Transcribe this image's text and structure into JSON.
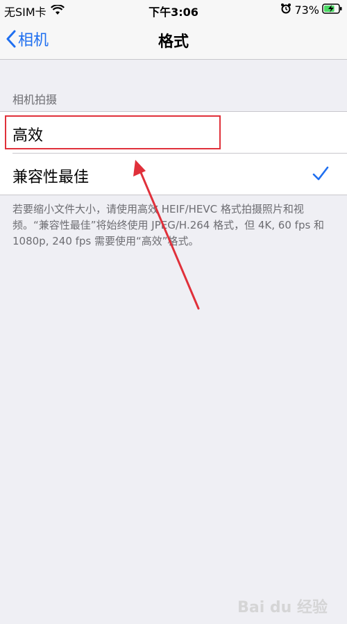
{
  "status_bar": {
    "carrier": "无SIM卡",
    "time": "下午3:06",
    "battery_percent": "73%",
    "battery_level": 0.73
  },
  "nav": {
    "back_label": "相机",
    "title": "格式"
  },
  "section": {
    "header": "相机拍摄",
    "options": [
      {
        "label": "高效",
        "selected": false
      },
      {
        "label": "兼容性最佳",
        "selected": true
      }
    ],
    "footer": "若要缩小文件大小，请使用高效 HEIF/HEVC 格式拍摄照片和视频。“兼容性最佳”将始终使用 JPEG/H.264 格式，但 4K, 60 fps 和 1080p, 240 fps 需要使用“高效”格式。"
  },
  "colors": {
    "accent": "#1f6ff0",
    "highlight": "#e0303a",
    "background": "#efeff4"
  },
  "watermark": "Bai du 经验"
}
